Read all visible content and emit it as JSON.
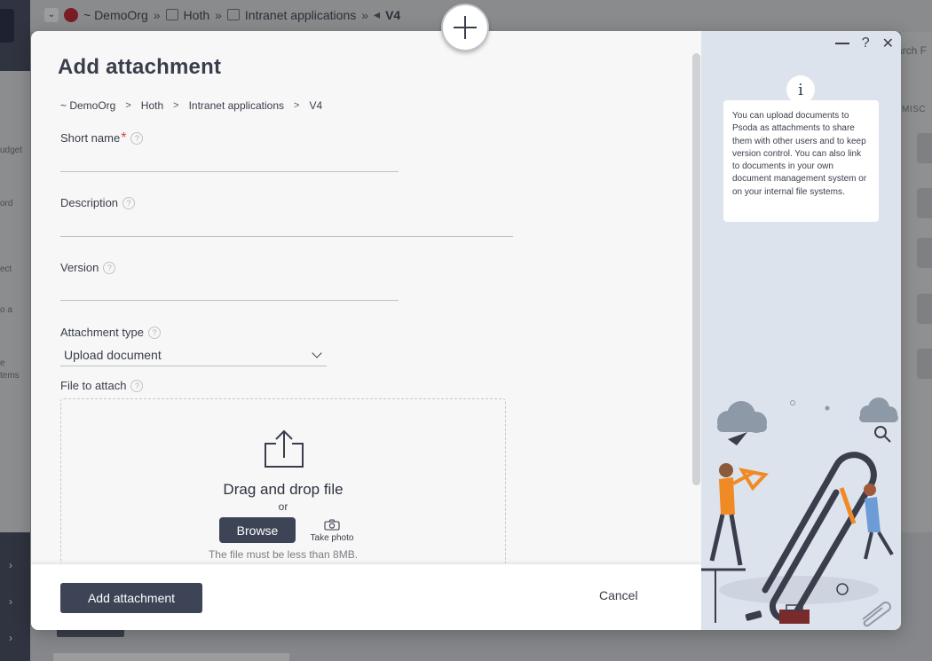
{
  "background": {
    "breadcrumb": [
      "~ DemoOrg",
      "Hoth",
      "Intranet applications",
      "V4"
    ],
    "search_placeholder": "arch F",
    "misc_label": "MISC",
    "side_labels": [
      "udget",
      "ord",
      "ect",
      "o a",
      "e",
      "tems"
    ]
  },
  "modal": {
    "title": "Add attachment",
    "breadcrumb": [
      "~ DemoOrg",
      "Hoth",
      "Intranet applications",
      "V4"
    ],
    "fields": {
      "short_name": {
        "label": "Short name",
        "required": "*",
        "value": ""
      },
      "description": {
        "label": "Description",
        "value": ""
      },
      "version": {
        "label": "Version",
        "value": ""
      },
      "attachment_type": {
        "label": "Attachment type",
        "selected": "Upload document"
      },
      "file_to_attach": {
        "label": "File to attach"
      }
    },
    "dropzone": {
      "title": "Drag and drop file",
      "or": "or",
      "browse": "Browse",
      "take_photo": "Take photo",
      "note": "The file must be less than 8MB."
    },
    "footer": {
      "submit": "Add attachment",
      "cancel": "Cancel"
    },
    "help_panel": {
      "info_icon": "i",
      "text": "You can upload documents to Psoda as attachments to share them with other users and to keep version control. You can also link to documents in your own document management system or on your internal file systems.",
      "controls": {
        "help": "?",
        "close": "✕"
      }
    }
  },
  "colors": {
    "primary_button": "#3d4456",
    "required": "#e0403a",
    "panel_bg": "#dde3ec"
  }
}
